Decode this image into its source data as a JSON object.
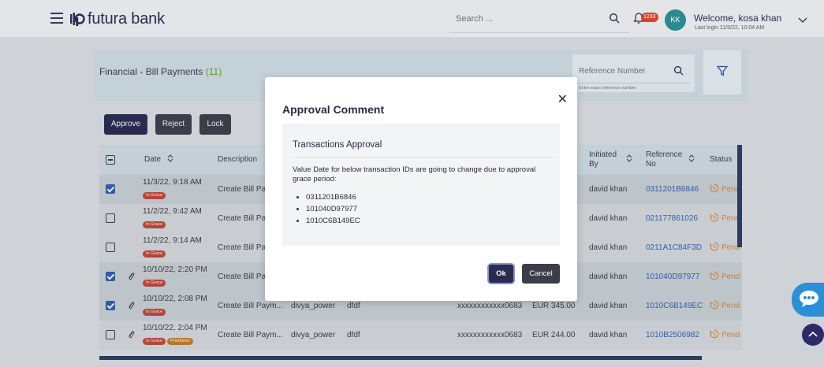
{
  "brand": {
    "name": "futura bank"
  },
  "header": {
    "search_placeholder": "Search ...",
    "notification_count": "1233",
    "avatar_initials": "KK",
    "welcome": "Welcome, kosa khan",
    "last_login": "Last login 11/5/22, 10:04 AM"
  },
  "page": {
    "title": "Financial - Bill Payments",
    "count": "(11)",
    "reference_placeholder": "Reference Number",
    "reference_hint": "Enter exact reference number"
  },
  "actions": {
    "approve": "Approve",
    "reject": "Reject",
    "lock": "Lock"
  },
  "table": {
    "headers": {
      "date": "Date",
      "description": "Description",
      "initiated_by_1": "Initiated",
      "initiated_by_2": "By",
      "reference_1": "Reference",
      "reference_2": "No",
      "status": "Status"
    },
    "rows": [
      {
        "checked": true,
        "attachment": false,
        "date": "11/3/22, 9:18 AM",
        "tags": [
          "In Grace"
        ],
        "description": "Create Bill Pay",
        "user": "",
        "remark": "",
        "account": "",
        "amount": "",
        "initiated_by": "david khan",
        "reference": "0311201B6846",
        "status": "Pend"
      },
      {
        "checked": false,
        "attachment": false,
        "date": "11/2/22, 9:42 AM",
        "tags": [
          "In Grace"
        ],
        "description": "Create Bill Pay",
        "user": "",
        "remark": "",
        "account": "",
        "amount": "",
        "initiated_by": "david khan",
        "reference": "021177861026",
        "status": "Pend"
      },
      {
        "checked": false,
        "attachment": false,
        "date": "11/2/22, 9:14 AM",
        "tags": [
          "In Grace"
        ],
        "description": "Create Bill Pay",
        "user": "",
        "remark": "",
        "account": "",
        "amount": "",
        "initiated_by": "david khan",
        "reference": "0211A1C84F3D",
        "status": "Pend"
      },
      {
        "checked": true,
        "attachment": true,
        "date": "10/10/22, 2:20 PM",
        "tags": [
          "In Grace"
        ],
        "description": "Create Bill Pay",
        "user": "",
        "remark": "",
        "account": "",
        "amount": "",
        "initiated_by": "david khan",
        "reference": "101040D97977",
        "status": "Pend"
      },
      {
        "checked": true,
        "attachment": true,
        "date": "10/10/22, 2:08 PM",
        "tags": [
          "In Grace"
        ],
        "description": "Create Bill Paym...",
        "user": "divya_power",
        "remark": "dfdf",
        "account": "xxxxxxxxxxxx0683",
        "amount": "EUR 345.00",
        "initiated_by": "david khan",
        "reference": "1010C6B149EC",
        "status": "Pend"
      },
      {
        "checked": false,
        "attachment": true,
        "date": "10/10/22, 2:04 PM",
        "tags": [
          "In Grace",
          "Prioritized"
        ],
        "description": "Create Bill Paym...",
        "user": "divya_power",
        "remark": "dfdf",
        "account": "xxxxxxxxxxxx0683",
        "amount": "EUR 244.00",
        "initiated_by": "david khan",
        "reference": "1010B2506982",
        "status": "Pend"
      }
    ]
  },
  "modal": {
    "title": "Approval Comment",
    "section_title": "Transactions Approval",
    "message": "Value Date for below transaction IDs are going to change due to approval grace period:",
    "ids": [
      "0311201B6846",
      "101040D97977",
      "1010C6B149EC"
    ],
    "ok": "Ok",
    "cancel": "Cancel"
  },
  "colors": {
    "primary": "#2b2b52",
    "link": "#2f5fa8",
    "pending": "#c8823a",
    "grace_tag": "#b5463a",
    "chat": "#2a8fd6"
  }
}
